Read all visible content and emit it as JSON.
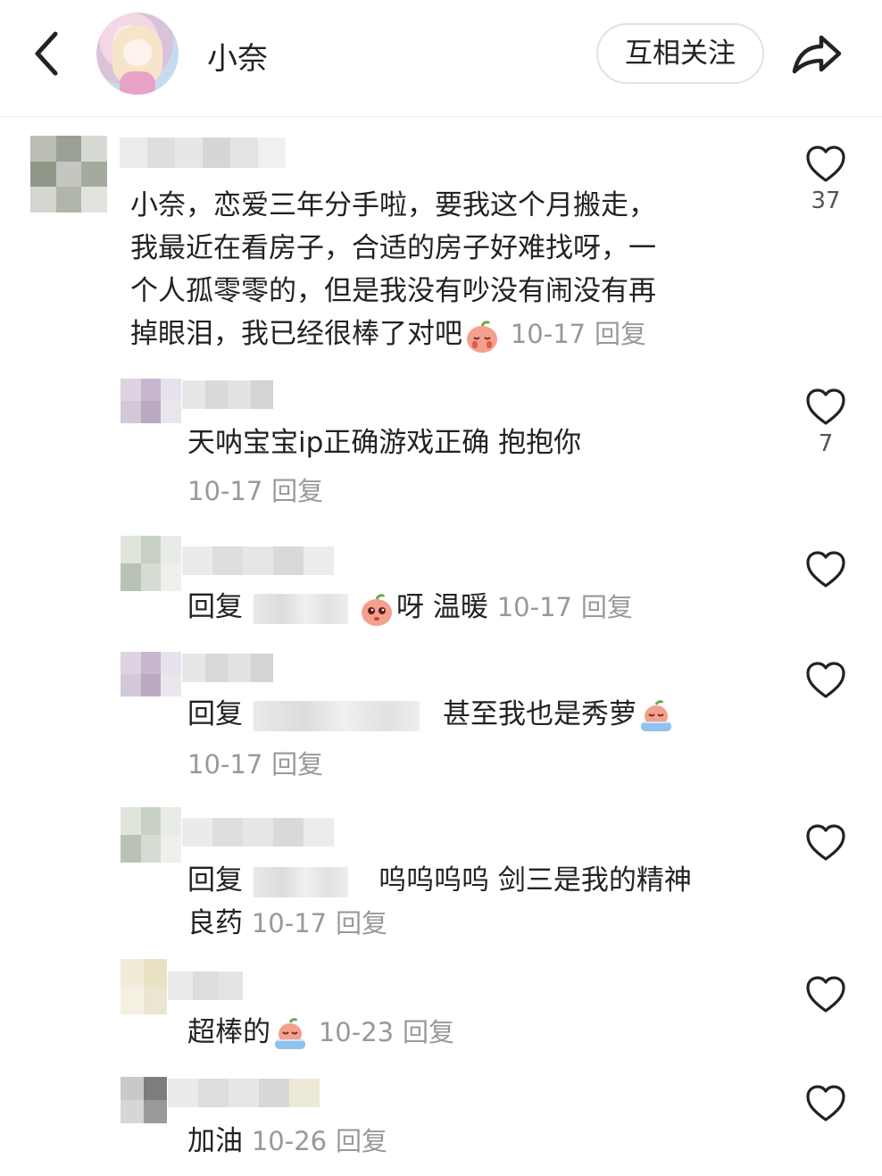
{
  "header": {
    "back_icon": "chevron-left-icon",
    "nickname": "小奈",
    "follow_label": "互相关注",
    "share_icon": "share-arrow-icon"
  },
  "comments": [
    {
      "lines": [
        "小奈，恋爱三年分手啦，要我这个月搬走，",
        "我最近在看房子，合适的房子好难找呀，一",
        "个人孤零零的，但是我没有吵没有闹没有再",
        "掉眼泪，我已经很棒了对吧"
      ],
      "emoji": "crying-peach-emoji",
      "date": "10-17",
      "reply": "回复",
      "likes": "37"
    },
    {
      "text": "天呐宝宝ip正确游戏正确 抱抱你",
      "date": "10-17",
      "reply": "回复",
      "likes": "7"
    },
    {
      "prefix": "回复",
      "text": "呀 温暖",
      "emoji": "pleading-peach-emoji",
      "date": "10-17",
      "reply": "回复",
      "likes": ""
    },
    {
      "prefix": "回复",
      "text": "甚至我也是秀萝",
      "emoji": "crying-peach-in-bath-emoji",
      "date": "10-17",
      "reply": "回复",
      "likes": ""
    },
    {
      "prefix": "回复",
      "text": "呜呜呜呜 剑三是我的精神",
      "text2": "良药",
      "date": "10-17",
      "reply": "回复",
      "likes": ""
    },
    {
      "text": "超棒的",
      "emoji": "crying-peach-in-bath-emoji",
      "date": "10-23",
      "reply": "回复",
      "likes": ""
    },
    {
      "text": "加油",
      "date": "10-26",
      "reply": "回复",
      "likes": ""
    }
  ],
  "icons": {
    "like": "heart-outline-icon"
  },
  "colors": {
    "meta": "#999999",
    "text": "#222222",
    "follow_border": "#e2e2e2"
  }
}
